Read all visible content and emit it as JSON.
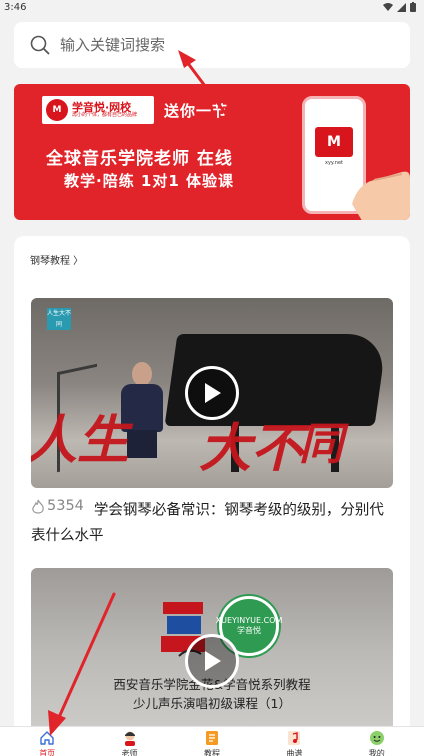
{
  "status_bar": {
    "time": "3:46"
  },
  "search": {
    "placeholder": "输入关键词搜索"
  },
  "banner": {
    "logo_mark": "M",
    "logo_name": "学音悦·网校",
    "logo_sub": "再小的个体，都有自己的品牌",
    "tag": "送你一节",
    "line1": "全球音乐学院老师 在线",
    "line2": "教学·陪练 1对1 体验课",
    "phone_logo": "M",
    "phone_url": "xyy.net"
  },
  "section": {
    "title": "钢琴教程 〉",
    "videos": [
      {
        "badge": "人生大不同",
        "views": "5354",
        "title": "学会钢琴必备常识：钢琴考级的级别，分别代表什么水平",
        "overlay_words": [
          "人生",
          "大不",
          "同"
        ]
      },
      {
        "logo_right": "XUEYINYUE.COM 学音悦",
        "caption_line1": "西安音乐学院金花&学音悦系列教程",
        "caption_line2": "少儿声乐演唱初级课程（1）"
      }
    ]
  },
  "tabbar": {
    "items": [
      {
        "label": "首页",
        "icon": "home-icon",
        "active": true
      },
      {
        "label": "老师",
        "icon": "teacher-icon",
        "active": false
      },
      {
        "label": "教程",
        "icon": "tutorial-icon",
        "active": false
      },
      {
        "label": "曲谱",
        "icon": "sheet-music-icon",
        "active": false
      },
      {
        "label": "我的",
        "icon": "profile-icon",
        "active": false
      }
    ]
  },
  "colors": {
    "accent": "#e1232a",
    "annotation_arrow": "#e1232a"
  }
}
